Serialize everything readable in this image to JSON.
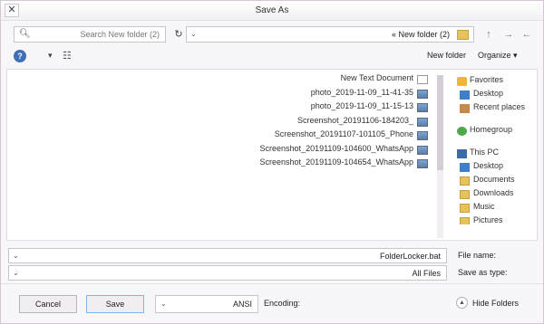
{
  "window": {
    "title": "Save As",
    "close_glyph": "✕"
  },
  "address": {
    "search_placeholder": "Search New folder (2)",
    "search_icon": "search-icon",
    "refresh_glyph": "↻",
    "dropdown_glyph": "⌄",
    "path": "« New folder (2)",
    "up_glyph": "↑",
    "forward_glyph": "→",
    "back_glyph": "←"
  },
  "toolbar": {
    "help_glyph": "?",
    "view_glyph": "▾",
    "viewopt_glyph": "☷",
    "new_folder": "New folder",
    "organize": "Organize ▾"
  },
  "files": [
    {
      "name": "New Text Document",
      "kind": "txt"
    },
    {
      "name": "photo_2019-11-09_11-41-35",
      "kind": "img"
    },
    {
      "name": "photo_2019-11-09_11-15-13",
      "kind": "img"
    },
    {
      "name": "Screenshot_20191106-184203_",
      "kind": "img"
    },
    {
      "name": "Screenshot_20191107-101105_Phone",
      "kind": "img"
    },
    {
      "name": "Screenshot_20191109-104600_WhatsApp",
      "kind": "img"
    },
    {
      "name": "Screenshot_20191109-104654_WhatsApp",
      "kind": "img"
    }
  ],
  "nav_pane": {
    "favorites": "Favorites",
    "fav_items": [
      "Desktop",
      "Recent places"
    ],
    "homegroup": "Homegroup",
    "this_pc": "This PC",
    "pc_items": [
      "Desktop",
      "Documents",
      "Downloads",
      "Music",
      "Pictures"
    ]
  },
  "form": {
    "file_name_label": "File name:",
    "file_name_value": "FolderLocker.bat",
    "save_type_label": "Save as type:",
    "save_type_value": "All Files"
  },
  "footer": {
    "hide_folders": "Hide Folders",
    "encoding_label": "Encoding:",
    "encoding_value": "ANSI",
    "save": "Save",
    "cancel": "Cancel"
  }
}
